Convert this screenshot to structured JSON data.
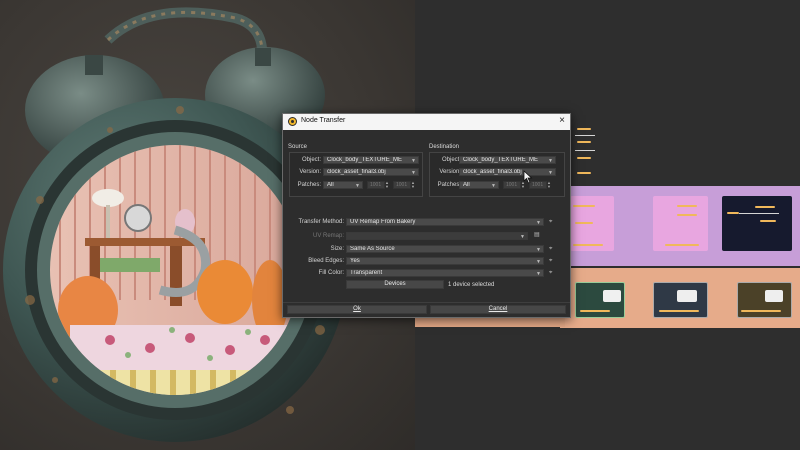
{
  "dialog": {
    "title": "Node Transfer",
    "close": "×"
  },
  "source": {
    "heading": "Source",
    "object_label": "Object:",
    "object_value": "Clock_body_TEXTURE_ME",
    "version_label": "Version:",
    "version_value": "clock_asset_final3.obj",
    "patches_label": "Patches:",
    "patches_value": "All",
    "patch_min": "1001",
    "patch_max": "1001"
  },
  "destination": {
    "heading": "Destination",
    "object_label": "Object:",
    "object_value": "Clock_body_TEXTURE_ME",
    "version_label": "Version:",
    "version_value": "clock_asset_final3.obj",
    "patches_label": "Patches:",
    "patches_value": "All",
    "patch_min": "1001",
    "patch_max": "1001"
  },
  "options": {
    "transfer_method_label": "Transfer Method:",
    "transfer_method_value": "UV Remap From Bakery",
    "uv_remap_label": "UV Remap:",
    "uv_remap_value": "",
    "size_label": "Size:",
    "size_value": "Same As Source",
    "bleed_label": "Bleed Edges:",
    "bleed_value": "Yes",
    "fill_label": "Fill Color:",
    "fill_value": "Transparent"
  },
  "devices": {
    "button_label": "Devices",
    "status": "1 device selected"
  },
  "buttons": {
    "ok_label": "Ok",
    "cancel_label": "Cancel"
  },
  "colors": {
    "accent": "#f1b72c",
    "frame_purple": "#c79ed8",
    "frame_peach": "#e6ab8a"
  }
}
